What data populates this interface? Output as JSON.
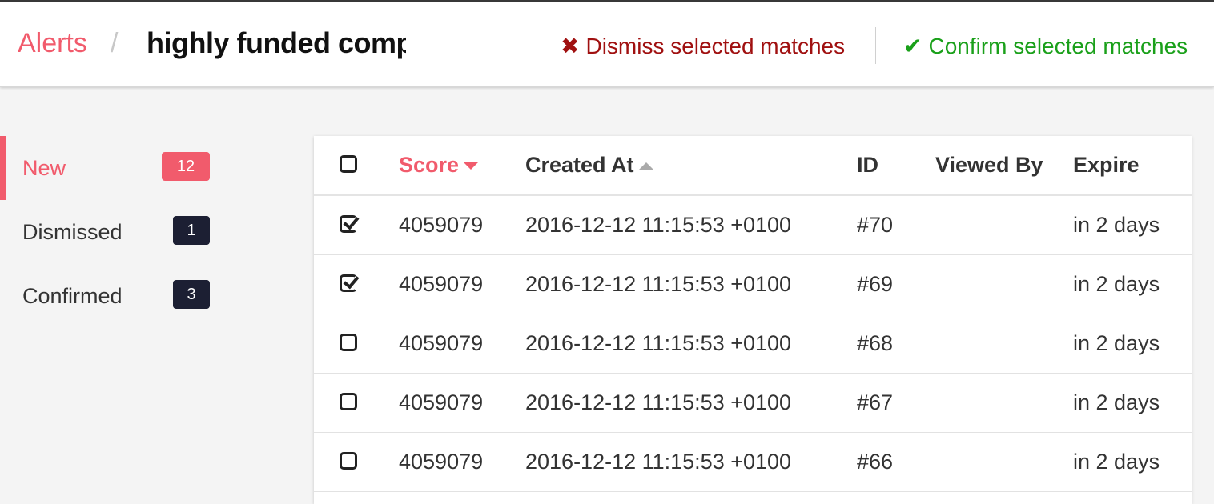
{
  "breadcrumb": {
    "root": "Alerts",
    "separator": "/",
    "current": "highly funded companies"
  },
  "actions": {
    "dismiss_label": "Dismiss selected matches",
    "dismiss_icon": "✖",
    "confirm_label": "Confirm selected matches",
    "confirm_icon": "✔"
  },
  "sidebar": {
    "items": [
      {
        "label": "New",
        "count": "12",
        "active": true
      },
      {
        "label": "Dismissed",
        "count": "1",
        "active": false
      },
      {
        "label": "Confirmed",
        "count": "3",
        "active": false
      }
    ]
  },
  "table": {
    "columns": {
      "score": "Score",
      "created_at": "Created At",
      "id": "ID",
      "viewed_by": "Viewed By",
      "expire": "Expire"
    },
    "rows": [
      {
        "checked": true,
        "score": "4059079",
        "created_at": "2016-12-12 11:15:53 +0100",
        "id": "#70",
        "viewed_by": "",
        "expire": "in 2 days"
      },
      {
        "checked": true,
        "score": "4059079",
        "created_at": "2016-12-12 11:15:53 +0100",
        "id": "#69",
        "viewed_by": "",
        "expire": "in 2 days"
      },
      {
        "checked": false,
        "score": "4059079",
        "created_at": "2016-12-12 11:15:53 +0100",
        "id": "#68",
        "viewed_by": "",
        "expire": "in 2 days"
      },
      {
        "checked": false,
        "score": "4059079",
        "created_at": "2016-12-12 11:15:53 +0100",
        "id": "#67",
        "viewed_by": "",
        "expire": "in 2 days"
      },
      {
        "checked": false,
        "score": "4059079",
        "created_at": "2016-12-12 11:15:53 +0100",
        "id": "#66",
        "viewed_by": "",
        "expire": "in 2 days"
      }
    ]
  },
  "colors": {
    "accent": "#f15b6c",
    "dismiss": "#a01010",
    "confirm": "#1aa01a",
    "badge": "#1c1f33"
  }
}
